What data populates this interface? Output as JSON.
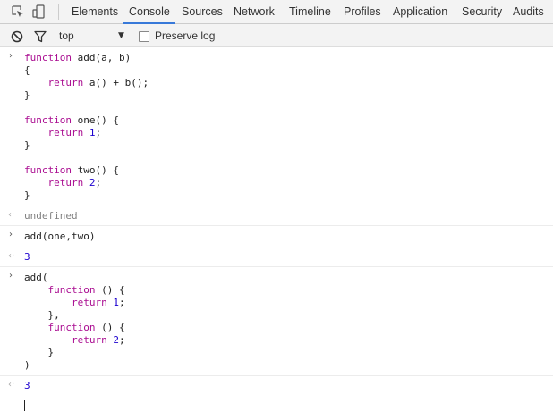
{
  "tabs": [
    {
      "label": "Elements",
      "selected": false
    },
    {
      "label": "Console",
      "selected": true
    },
    {
      "label": "Sources",
      "selected": false
    },
    {
      "label": "Network",
      "selected": false
    },
    {
      "label": "Timeline",
      "selected": false
    },
    {
      "label": "Profiles",
      "selected": false
    },
    {
      "label": "Application",
      "selected": false
    },
    {
      "label": "Security",
      "selected": false
    },
    {
      "label": "Audits",
      "selected": false
    }
  ],
  "toolbar_icons": [
    "inspect-element-icon",
    "device-toolbar-icon"
  ],
  "filter_bar": {
    "icons": [
      "clear-console-icon",
      "filter-icon"
    ],
    "context": "top",
    "context_arrow": "▼",
    "preserve_log_label": "Preserve log",
    "preserve_log_checked": false
  },
  "console": {
    "prompt_glyph": "›",
    "result_glyph": "‹·",
    "entries": [
      {
        "type": "input",
        "lines": [
          "function add(a, b)",
          "{",
          "    return a() + b();",
          "}",
          "",
          "function one() {",
          "    return 1;",
          "}",
          "",
          "function two() {",
          "    return 2;",
          "}"
        ]
      },
      {
        "type": "result",
        "value": "undefined"
      },
      {
        "type": "input",
        "lines": [
          "add(one,two)"
        ]
      },
      {
        "type": "result",
        "value": "3"
      },
      {
        "type": "input",
        "lines": [
          "add(",
          "    function () {",
          "        return 1;",
          "    },",
          "    function () {",
          "        return 2;",
          "    }",
          ")"
        ]
      },
      {
        "type": "result",
        "value": "3"
      }
    ]
  },
  "colors": {
    "keyword": "#aa0d91",
    "number": "#1c00cf",
    "selected_tab_underline": "#3879d9",
    "toolbar_bg": "#f3f3f3"
  }
}
